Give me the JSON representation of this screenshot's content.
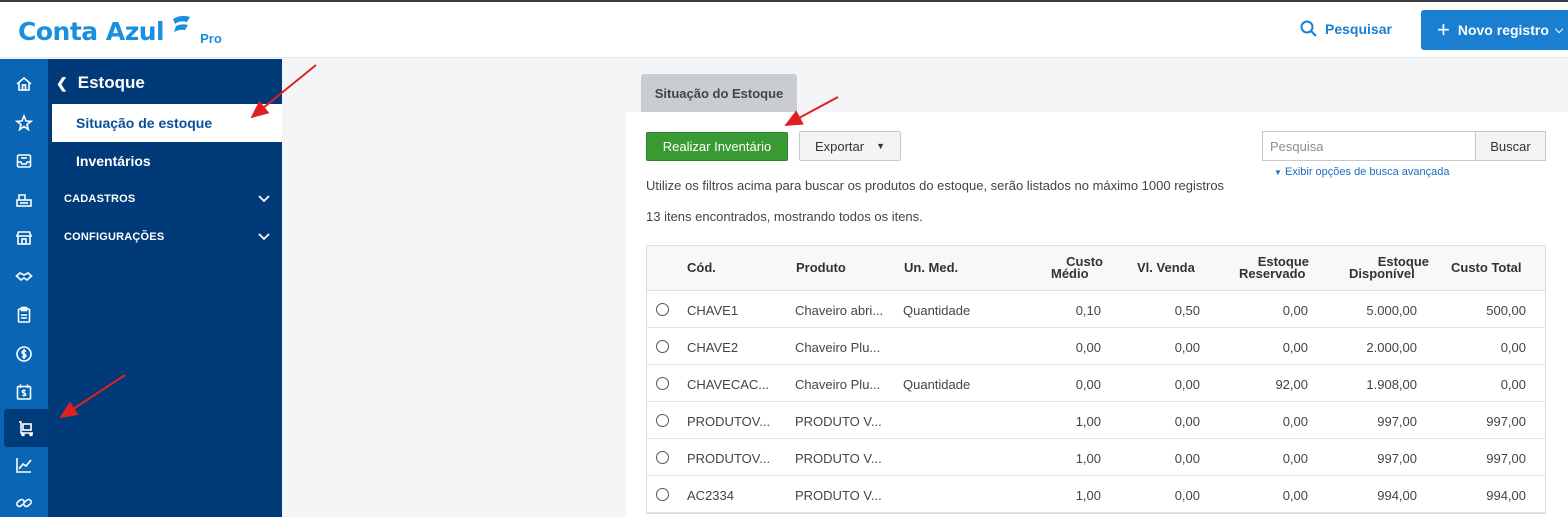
{
  "header": {
    "logo_text": "Conta Azul",
    "logo_badge": "Pro",
    "search_label": "Pesquisar",
    "new_button_label": "Novo registro"
  },
  "rail": {
    "icons": [
      "home-icon",
      "star-icon",
      "inbox-icon",
      "cash-register-icon",
      "store-icon",
      "handshake-icon",
      "clipboard-icon",
      "dollar-icon",
      "calendar-dollar-icon",
      "inventory-icon",
      "chart-icon",
      "link-icon"
    ],
    "active_icon": "inventory-icon"
  },
  "sidebar": {
    "title": "Estoque",
    "items": [
      {
        "label": "Situação de estoque",
        "active": true
      },
      {
        "label": "Inventários",
        "active": false
      }
    ],
    "groups": [
      {
        "label": "CADASTROS"
      },
      {
        "label": "CONFIGURAÇÕES"
      }
    ]
  },
  "main": {
    "tab_label": "Situação do Estoque",
    "inventory_button": "Realizar Inventário",
    "export_button": "Exportar",
    "search_placeholder": "Pesquisa",
    "search_button": "Buscar",
    "advanced_search": "Exibir opções de busca avançada",
    "filter_hint": "Utilize os filtros acima para buscar os produtos do estoque, serão listados no máximo 1000 registros",
    "result_count": "13 itens encontrados, mostrando todos os itens."
  },
  "table": {
    "headers": {
      "cod": "Cód.",
      "produto": "Produto",
      "un_med": "Un. Med.",
      "custo_medio_1": "Custo",
      "custo_medio_2": "Médio",
      "vl_venda": "Vl. Venda",
      "estoque_reservado_1": "Estoque",
      "estoque_reservado_2": "Reservado",
      "estoque_disponivel_1": "Estoque",
      "estoque_disponivel_2": "Disponível",
      "custo_total": "Custo Total"
    },
    "rows": [
      {
        "cod": "CHAVE1",
        "produto": "Chaveiro abri...",
        "un_med": "Quantidade",
        "custo_medio": "0,10",
        "vl_venda": "0,50",
        "reservado": "0,00",
        "disponivel": "5.000,00",
        "custo_total": "500,00"
      },
      {
        "cod": "CHAVE2",
        "produto": "Chaveiro Plu...",
        "un_med": "",
        "custo_medio": "0,00",
        "vl_venda": "0,00",
        "reservado": "0,00",
        "disponivel": "2.000,00",
        "custo_total": "0,00"
      },
      {
        "cod": "CHAVECAC...",
        "produto": "Chaveiro Plu...",
        "un_med": "Quantidade",
        "custo_medio": "0,00",
        "vl_venda": "0,00",
        "reservado": "92,00",
        "disponivel": "1.908,00",
        "custo_total": "0,00"
      },
      {
        "cod": "PRODUTOV...",
        "produto": "PRODUTO V...",
        "un_med": "",
        "custo_medio": "1,00",
        "vl_venda": "0,00",
        "reservado": "0,00",
        "disponivel": "997,00",
        "custo_total": "997,00"
      },
      {
        "cod": "PRODUTOV...",
        "produto": "PRODUTO V...",
        "un_med": "",
        "custo_medio": "1,00",
        "vl_venda": "0,00",
        "reservado": "0,00",
        "disponivel": "997,00",
        "custo_total": "997,00"
      },
      {
        "cod": "AC2334",
        "produto": "PRODUTO V...",
        "un_med": "",
        "custo_medio": "1,00",
        "vl_venda": "0,00",
        "reservado": "0,00",
        "disponivel": "994,00",
        "custo_total": "994,00"
      }
    ]
  },
  "colors": {
    "brand_blue": "#1a8fdd",
    "rail_blue": "#0a66b5",
    "sidebar_navy": "#013a78",
    "primary_button": "#1a7fd0",
    "inventory_green": "#3a9b34",
    "annotation_red": "#e02020"
  }
}
